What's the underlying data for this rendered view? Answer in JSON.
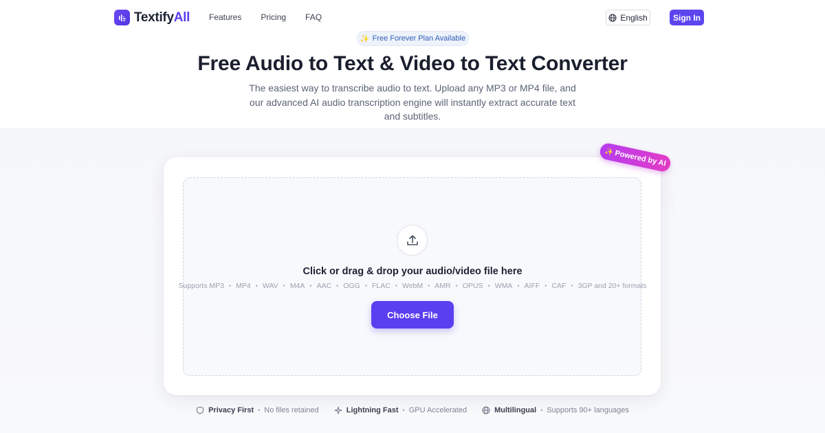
{
  "brand": {
    "name_part1": "Textify",
    "name_part2": "All"
  },
  "nav": {
    "links": [
      "Features",
      "Pricing",
      "FAQ"
    ],
    "language": "English",
    "sign_in": "Sign In"
  },
  "hero": {
    "badge": "Free Forever Plan Available",
    "title": "Free Audio to Text & Video to Text Converter",
    "subtitle": "The easiest way to transcribe audio to text. Upload any MP3 or MP4 file, and our advanced AI audio transcription engine will instantly extract accurate text and subtitles."
  },
  "upload": {
    "powered_badge": "Powered by AI",
    "title": "Click or drag & drop your audio/video file here",
    "formats_prefix": "Supports",
    "formats": [
      "MP3",
      "MP4",
      "WAV",
      "M4A",
      "AAC",
      "OGG",
      "FLAC",
      "WebM",
      "AMR",
      "OPUS",
      "WMA",
      "AIFF",
      "CAF",
      "3GP and 20+ formats"
    ],
    "button": "Choose File"
  },
  "features": [
    {
      "icon": "shield-icon",
      "title": "Privacy First",
      "desc": "No files retained"
    },
    {
      "icon": "sparkle-icon",
      "title": "Lightning Fast",
      "desc": "GPU Accelerated"
    },
    {
      "icon": "globe-icon",
      "title": "Multilingual",
      "desc": "Supports 90+ languages"
    }
  ],
  "colors": {
    "primary": "#5a3ff0",
    "badge_text": "#2f5fb6",
    "ai_gradient_start": "#b63cf2",
    "ai_gradient_end": "#e33cc4"
  }
}
